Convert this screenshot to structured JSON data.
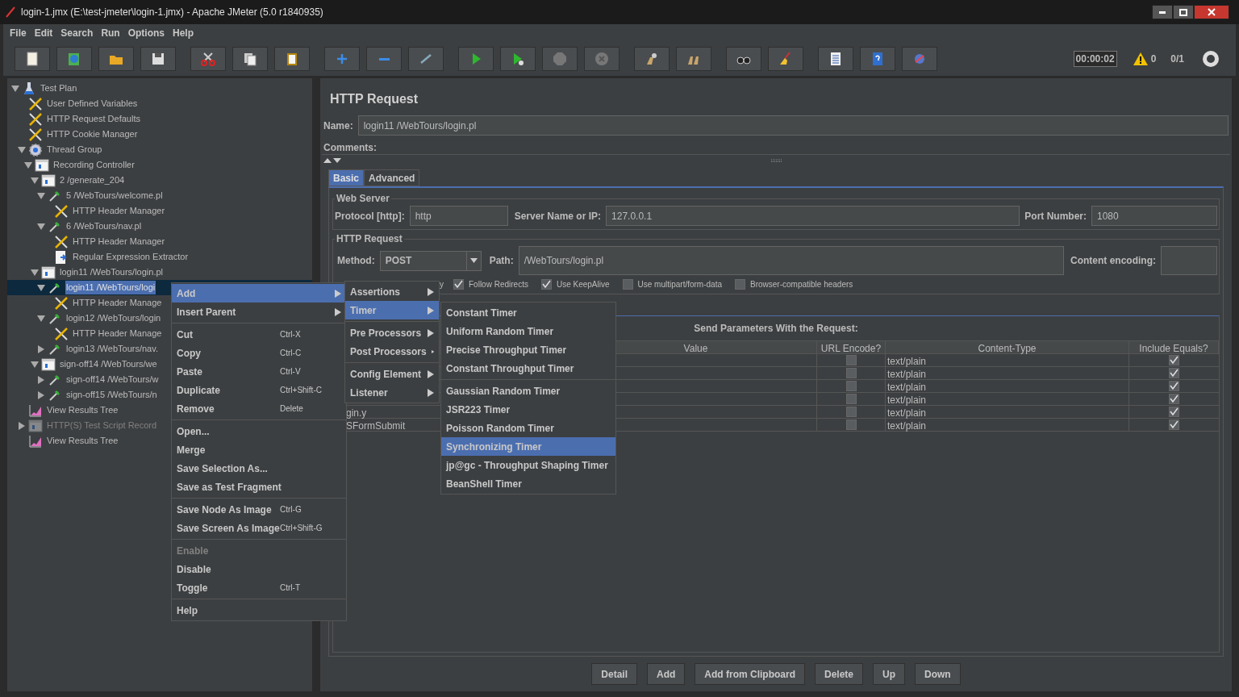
{
  "window": {
    "title": "login-1.jmx (E:\\test-jmeter\\login-1.jmx) - Apache JMeter (5.0 r1840935)"
  },
  "menu_bar": [
    "File",
    "Edit",
    "Search",
    "Run",
    "Options",
    "Help"
  ],
  "status": {
    "timer": "00:00:02",
    "warnings": "0",
    "threads": "0/1"
  },
  "tree": [
    {
      "label": "Test Plan",
      "kind": "plan",
      "expanded": true,
      "selected": false,
      "disabled": false,
      "children": [
        {
          "label": "User Defined Variables",
          "kind": "config",
          "selected": false,
          "disabled": false
        },
        {
          "label": "HTTP Request Defaults",
          "kind": "config",
          "selected": false,
          "disabled": false
        },
        {
          "label": "HTTP Cookie Manager",
          "kind": "config",
          "selected": false,
          "disabled": false
        },
        {
          "label": "Thread Group",
          "kind": "threads",
          "expanded": true,
          "selected": false,
          "disabled": false,
          "children": [
            {
              "label": "Recording Controller",
              "kind": "controller",
              "expanded": true,
              "selected": false,
              "disabled": false,
              "children": [
                {
                  "label": "2 /generate_204",
                  "kind": "controller",
                  "expanded": true,
                  "selected": false,
                  "disabled": false,
                  "children": [
                    {
                      "label": "5 /WebTours/welcome.pl",
                      "kind": "sampler",
                      "expanded": true,
                      "selected": false,
                      "disabled": false,
                      "children": [
                        {
                          "label": "HTTP Header Manager",
                          "kind": "config",
                          "selected": false,
                          "disabled": false
                        }
                      ]
                    },
                    {
                      "label": "6 /WebTours/nav.pl",
                      "kind": "sampler",
                      "expanded": true,
                      "selected": false,
                      "disabled": false,
                      "children": [
                        {
                          "label": "HTTP Header Manager",
                          "kind": "config",
                          "selected": false,
                          "disabled": false
                        },
                        {
                          "label": "Regular Expression Extractor",
                          "kind": "extractor",
                          "selected": false,
                          "disabled": false
                        }
                      ]
                    }
                  ]
                },
                {
                  "label": "login11 /WebTours/login.pl",
                  "kind": "controller",
                  "expanded": true,
                  "selected": false,
                  "disabled": false,
                  "children": [
                    {
                      "label": "login11 /WebTours/logi",
                      "kind": "sampler",
                      "expanded": true,
                      "selected": true,
                      "disabled": false,
                      "children": [
                        {
                          "label": "HTTP Header Manage",
                          "kind": "config",
                          "selected": false,
                          "disabled": false
                        }
                      ]
                    },
                    {
                      "label": "login12 /WebTours/login",
                      "kind": "sampler",
                      "expanded": true,
                      "selected": false,
                      "disabled": false,
                      "children": [
                        {
                          "label": "HTTP Header Manage",
                          "kind": "config",
                          "selected": false,
                          "disabled": false
                        }
                      ]
                    },
                    {
                      "label": "login13 /WebTours/nav.",
                      "kind": "sampler",
                      "expanded": false,
                      "selected": false,
                      "disabled": false
                    }
                  ]
                },
                {
                  "label": "sign-off14 /WebTours/we",
                  "kind": "controller",
                  "expanded": true,
                  "selected": false,
                  "disabled": false,
                  "children": [
                    {
                      "label": "sign-off14 /WebTours/w",
                      "kind": "sampler",
                      "expanded": false,
                      "selected": false,
                      "disabled": false
                    },
                    {
                      "label": "sign-off15 /WebTours/n",
                      "kind": "sampler",
                      "expanded": false,
                      "selected": false,
                      "disabled": false
                    }
                  ]
                }
              ]
            }
          ]
        },
        {
          "label": "View Results Tree",
          "kind": "listener",
          "selected": false,
          "disabled": false
        },
        {
          "label": "HTTP(S) Test Script Record",
          "kind": "controller",
          "expanded": false,
          "selected": false,
          "disabled": true
        },
        {
          "label": "View Results Tree",
          "kind": "listener",
          "selected": false,
          "disabled": false
        }
      ]
    }
  ],
  "editor": {
    "title": "HTTP Request",
    "name_label": "Name:",
    "name": "login11 /WebTours/login.pl",
    "comments_label": "Comments:",
    "tabs": [
      {
        "label": "Basic",
        "selected": true
      },
      {
        "label": "Advanced",
        "selected": false
      }
    ],
    "web_server": {
      "legend": "Web Server",
      "protocol_label": "Protocol [http]:",
      "protocol": "http",
      "server_label": "Server Name or IP:",
      "server": "127.0.0.1",
      "port_label": "Port Number:",
      "port": "1080"
    },
    "http_request": {
      "legend": "HTTP Request",
      "method_label": "Method:",
      "method": "POST",
      "path_label": "Path:",
      "path": "/WebTours/login.pl",
      "encoding_label": "Content encoding:"
    },
    "option_fragment": "y",
    "options": [
      {
        "label": "Follow Redirects",
        "checked": true
      },
      {
        "label": "Use KeepAlive",
        "checked": true
      },
      {
        "label": "Use multipart/form-data",
        "checked": false
      },
      {
        "label": "Browser-compatible headers",
        "checked": false
      }
    ],
    "params_title": "Send Parameters With the Request:",
    "columns": [
      "Value",
      "URL Encode?",
      "Content-Type",
      "Include Equals?"
    ],
    "rows": [
      {
        "name_fragment": "",
        "url_encode": false,
        "content_type": "text/plain",
        "include_equals": true
      },
      {
        "name_fragment": "",
        "url_encode": false,
        "content_type": "text/plain",
        "include_equals": true
      },
      {
        "name_fragment": "",
        "url_encode": false,
        "content_type": "text/plain",
        "include_equals": true
      },
      {
        "name_fragment": "",
        "url_encode": false,
        "content_type": "text/plain",
        "include_equals": true
      },
      {
        "name_fragment": "gin.y",
        "url_encode": false,
        "content_type": "text/plain",
        "include_equals": true
      },
      {
        "name_fragment": "SFormSubmit",
        "url_encode": false,
        "content_type": "text/plain",
        "include_equals": true
      }
    ],
    "buttons": [
      "Detail",
      "Add",
      "Add from Clipboard",
      "Delete",
      "Up",
      "Down"
    ]
  },
  "context_menu": [
    {
      "kind": "item",
      "label": "Add",
      "submenu": true,
      "selected": true,
      "disabled": false
    },
    {
      "kind": "item",
      "label": "Insert Parent",
      "submenu": true,
      "selected": false,
      "disabled": false
    },
    {
      "kind": "separator"
    },
    {
      "kind": "item",
      "label": "Cut",
      "shortcut": "Ctrl-X",
      "selected": false,
      "disabled": false
    },
    {
      "kind": "item",
      "label": "Copy",
      "shortcut": "Ctrl-C",
      "selected": false,
      "disabled": false
    },
    {
      "kind": "item",
      "label": "Paste",
      "shortcut": "Ctrl-V",
      "selected": false,
      "disabled": false
    },
    {
      "kind": "item",
      "label": "Duplicate",
      "shortcut": "Ctrl+Shift-C",
      "selected": false,
      "disabled": false
    },
    {
      "kind": "item",
      "label": "Remove",
      "shortcut": "Delete",
      "selected": false,
      "disabled": false
    },
    {
      "kind": "separator"
    },
    {
      "kind": "item",
      "label": "Open...",
      "selected": false,
      "disabled": false
    },
    {
      "kind": "item",
      "label": "Merge",
      "selected": false,
      "disabled": false
    },
    {
      "kind": "item",
      "label": "Save Selection As...",
      "selected": false,
      "disabled": false
    },
    {
      "kind": "item",
      "label": "Save as Test Fragment",
      "selected": false,
      "disabled": false
    },
    {
      "kind": "separator"
    },
    {
      "kind": "item",
      "label": "Save Node As Image",
      "shortcut": "Ctrl-G",
      "selected": false,
      "disabled": false
    },
    {
      "kind": "item",
      "label": "Save Screen As Image",
      "shortcut": "Ctrl+Shift-G",
      "selected": false,
      "disabled": false
    },
    {
      "kind": "separator"
    },
    {
      "kind": "item",
      "label": "Enable",
      "selected": false,
      "disabled": true
    },
    {
      "kind": "item",
      "label": "Disable",
      "selected": false,
      "disabled": false
    },
    {
      "kind": "item",
      "label": "Toggle",
      "shortcut": "Ctrl-T",
      "selected": false,
      "disabled": false
    },
    {
      "kind": "separator"
    },
    {
      "kind": "item",
      "label": "Help",
      "selected": false,
      "disabled": false
    }
  ],
  "add_submenu": [
    {
      "kind": "item",
      "label": "Assertions",
      "submenu": true,
      "selected": false
    },
    {
      "kind": "item",
      "label": "Timer",
      "submenu": true,
      "selected": true
    },
    {
      "kind": "separator"
    },
    {
      "kind": "item",
      "label": "Pre Processors",
      "submenu": true,
      "selected": false
    },
    {
      "kind": "item",
      "label": "Post Processors",
      "submenu": true,
      "selected": false
    },
    {
      "kind": "separator"
    },
    {
      "kind": "item",
      "label": "Config Element",
      "submenu": true,
      "selected": false
    },
    {
      "kind": "item",
      "label": "Listener",
      "submenu": true,
      "selected": false
    }
  ],
  "timer_submenu": [
    {
      "kind": "item",
      "label": "Constant Timer",
      "selected": false
    },
    {
      "kind": "item",
      "label": "Uniform Random Timer",
      "selected": false
    },
    {
      "kind": "item",
      "label": "Precise Throughput Timer",
      "selected": false
    },
    {
      "kind": "item",
      "label": "Constant Throughput Timer",
      "selected": false
    },
    {
      "kind": "separator"
    },
    {
      "kind": "item",
      "label": "Gaussian Random Timer",
      "selected": false
    },
    {
      "kind": "item",
      "label": "JSR223 Timer",
      "selected": false
    },
    {
      "kind": "item",
      "label": "Poisson Random Timer",
      "selected": false
    },
    {
      "kind": "item",
      "label": "Synchronizing Timer",
      "selected": true
    },
    {
      "kind": "item",
      "label": "jp@gc - Throughput Shaping Timer",
      "selected": false
    },
    {
      "kind": "item",
      "label": "BeanShell Timer",
      "selected": false
    }
  ]
}
